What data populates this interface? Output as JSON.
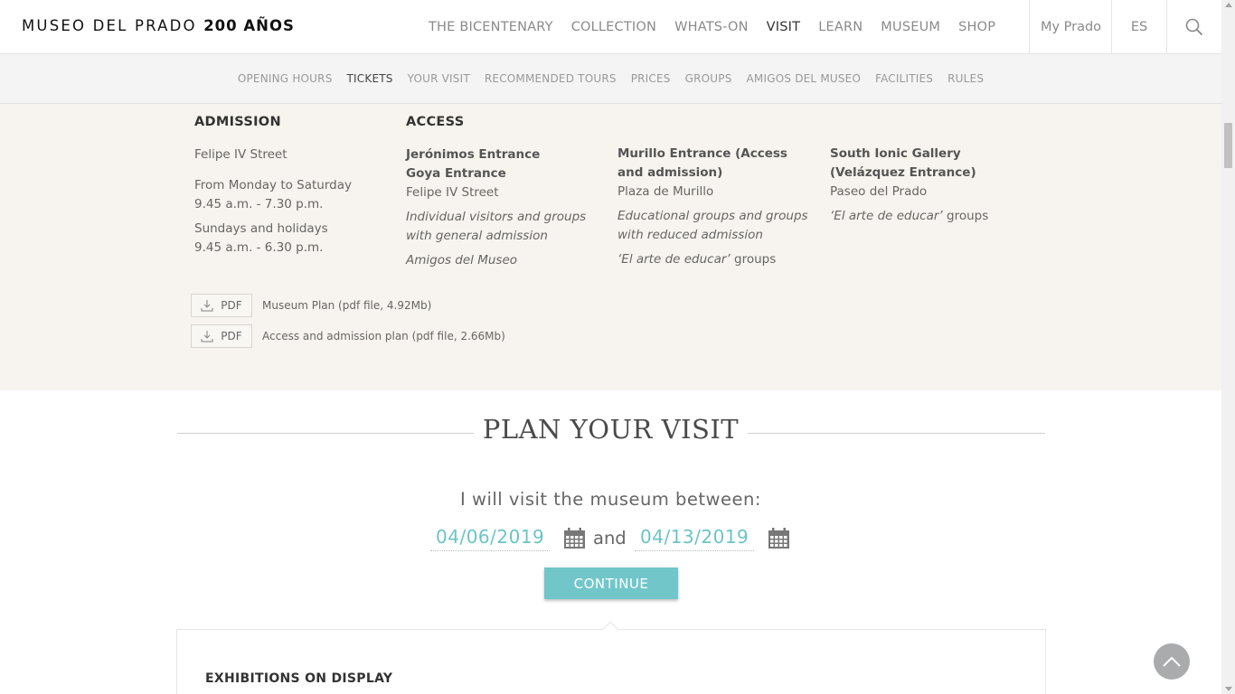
{
  "header": {
    "logo_text": "MUSEO DEL PRADO",
    "logo_bold": "200 AÑOS",
    "nav": [
      {
        "label": "THE BICENTENARY"
      },
      {
        "label": "COLLECTION"
      },
      {
        "label": "WHATS-ON"
      },
      {
        "label": "VISIT"
      },
      {
        "label": "LEARN"
      },
      {
        "label": "MUSEUM"
      },
      {
        "label": "SHOP"
      }
    ],
    "my_prado": "My Prado",
    "lang": "ES",
    "search_icon": "search-icon"
  },
  "subnav": [
    {
      "label": "OPENING HOURS"
    },
    {
      "label": "TICKETS"
    },
    {
      "label": "YOUR VISIT"
    },
    {
      "label": "RECOMMENDED TOURS"
    },
    {
      "label": "PRICES"
    },
    {
      "label": "GROUPS"
    },
    {
      "label": "AMIGOS DEL MUSEO"
    },
    {
      "label": "FACILITIES"
    },
    {
      "label": "RULES"
    }
  ],
  "admission": {
    "title": "ADMISSION",
    "street": "Felipe IV Street",
    "weekday_days": "From Monday to Saturday",
    "weekday_hours": "9.45 a.m. - 7.30 p.m.",
    "holiday_days": "Sundays and holidays",
    "holiday_hours": "9.45 a.m. - 6.30 p.m."
  },
  "access": {
    "title": "ACCESS",
    "col1": {
      "entrance1": "Jerónimos Entrance",
      "entrance2": "Goya Entrance",
      "street": "Felipe IV Street",
      "note1": "Individual visitors and groups with general admission",
      "note2": "Amigos del Museo"
    },
    "col2": {
      "entrance": "Murillo Entrance (Access and admission)",
      "street": "Plaza de Murillo",
      "note1": "Educational groups and groups with reduced admission",
      "note2_italic": "‘El arte de educar’",
      "note2_plain": " groups"
    },
    "col3": {
      "entrance": "South Ionic Gallery (Velázquez Entrance)",
      "street": "Paseo del Prado",
      "note_italic": "‘El arte de educar’",
      "note_plain": " groups"
    }
  },
  "downloads": [
    {
      "button": "PDF",
      "label": "Museum Plan (pdf file, 4.92Mb)"
    },
    {
      "button": "PDF",
      "label": "Access and admission plan (pdf file, 2.66Mb)"
    }
  ],
  "plan": {
    "title": "PLAN YOUR VISIT",
    "lead": "I will visit the museum between:",
    "date_from": "04/06/2019",
    "and": "and",
    "date_to": "04/13/2019",
    "continue": "CONTINUE"
  },
  "exhibitions": {
    "title": "EXHIBITIONS ON DISPLAY"
  },
  "colors": {
    "accent": "#71c6c9",
    "date_text": "#6cc4c6",
    "beige_bg": "#f7f3ee"
  }
}
